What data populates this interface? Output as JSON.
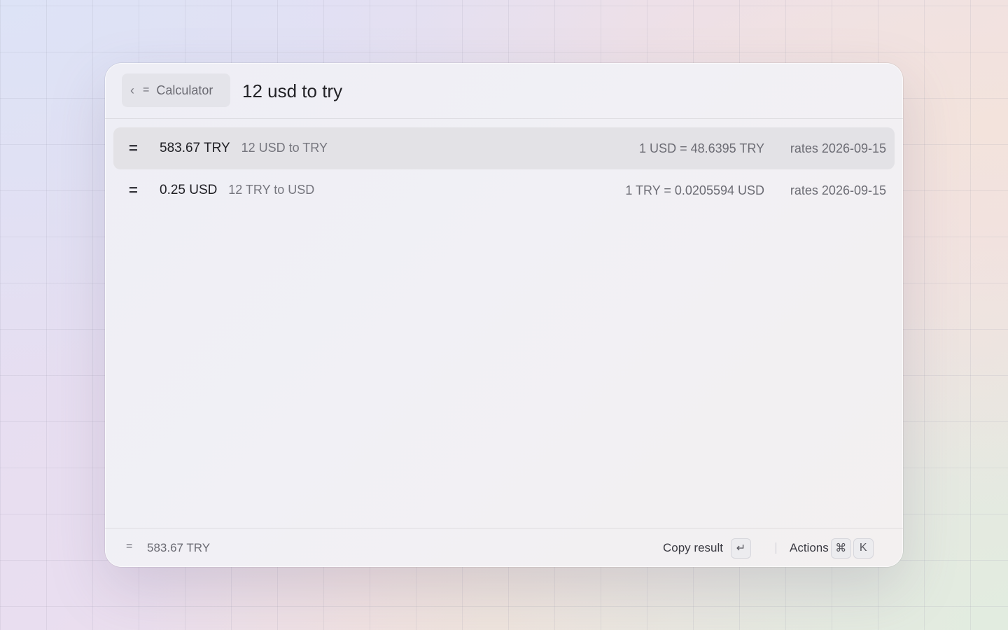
{
  "header": {
    "breadcrumb": {
      "back_glyph": "‹",
      "icon": "=",
      "label": "Calculator"
    },
    "query": "12 usd to try"
  },
  "results": [
    {
      "icon": "=",
      "value": "583.67 TRY",
      "description": "12 USD to TRY",
      "rate": "1 USD = 48.6395 TRY",
      "rates_date": "rates 2026-09-15",
      "selected": true
    },
    {
      "icon": "=",
      "value": "0.25 USD",
      "description": "12 TRY to USD",
      "rate": "1 TRY = 0.0205594 USD",
      "rates_date": "rates 2026-09-15",
      "selected": false
    }
  ],
  "footer": {
    "icon": "=",
    "current_result": "583.67 TRY",
    "copy_label": "Copy result",
    "copy_key": "↵",
    "actions_label": "Actions",
    "actions_keys": [
      "⌘",
      "K"
    ]
  },
  "colors": {
    "selected_row": "#e3e2e6",
    "primary_text": "#1f1f24",
    "secondary_text": "#76767e"
  }
}
